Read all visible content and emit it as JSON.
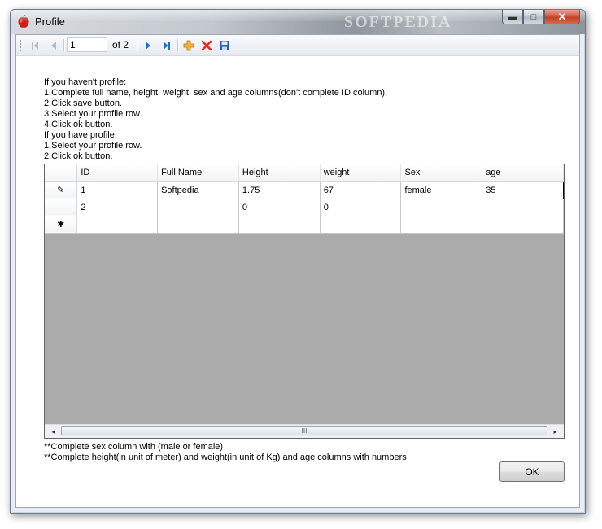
{
  "window": {
    "title": "Profile",
    "watermark": "SOFTPEDIA",
    "minimize_label": "▬",
    "maximize_label": "□",
    "close_label": "✕"
  },
  "navigator": {
    "position": "1",
    "count_label": "of 2"
  },
  "instructions": [
    "If you haven't profile:",
    "1.Complete full name, height, weight, sex and age columns(don't complete ID column).",
    "2.Click save button.",
    "3.Select your profile row.",
    "4.Click ok button.",
    "If you have profile:",
    "1.Select your profile row.",
    "2.Click ok button."
  ],
  "grid": {
    "columns": [
      "ID",
      "Full Name",
      "Height",
      "weight",
      "Sex",
      "age"
    ],
    "rows": [
      {
        "marker": "✎",
        "cells": [
          "1",
          "Softpedia",
          "1.75",
          "67",
          "female",
          "35"
        ]
      },
      {
        "marker": "",
        "cells": [
          "2",
          "",
          "0",
          "0",
          "",
          ""
        ]
      },
      {
        "marker": "✱",
        "cells": [
          "",
          "",
          "",
          "",
          "",
          ""
        ]
      }
    ],
    "scroll_left": "◂",
    "scroll_right": "▸",
    "scroll_grip": "III"
  },
  "notes": [
    "**Complete sex column with (male or female)",
    "**Complete height(in unit of meter) and weight(in unit of Kg) and age columns with numbers"
  ],
  "ok_button": {
    "label": "OK"
  },
  "colors": {
    "nav_blue": "#1f6fc9",
    "add_orange": "#f0a020",
    "delete_red": "#e0301e",
    "save_blue": "#2a5db0",
    "grid_empty_area": "#ababab"
  }
}
